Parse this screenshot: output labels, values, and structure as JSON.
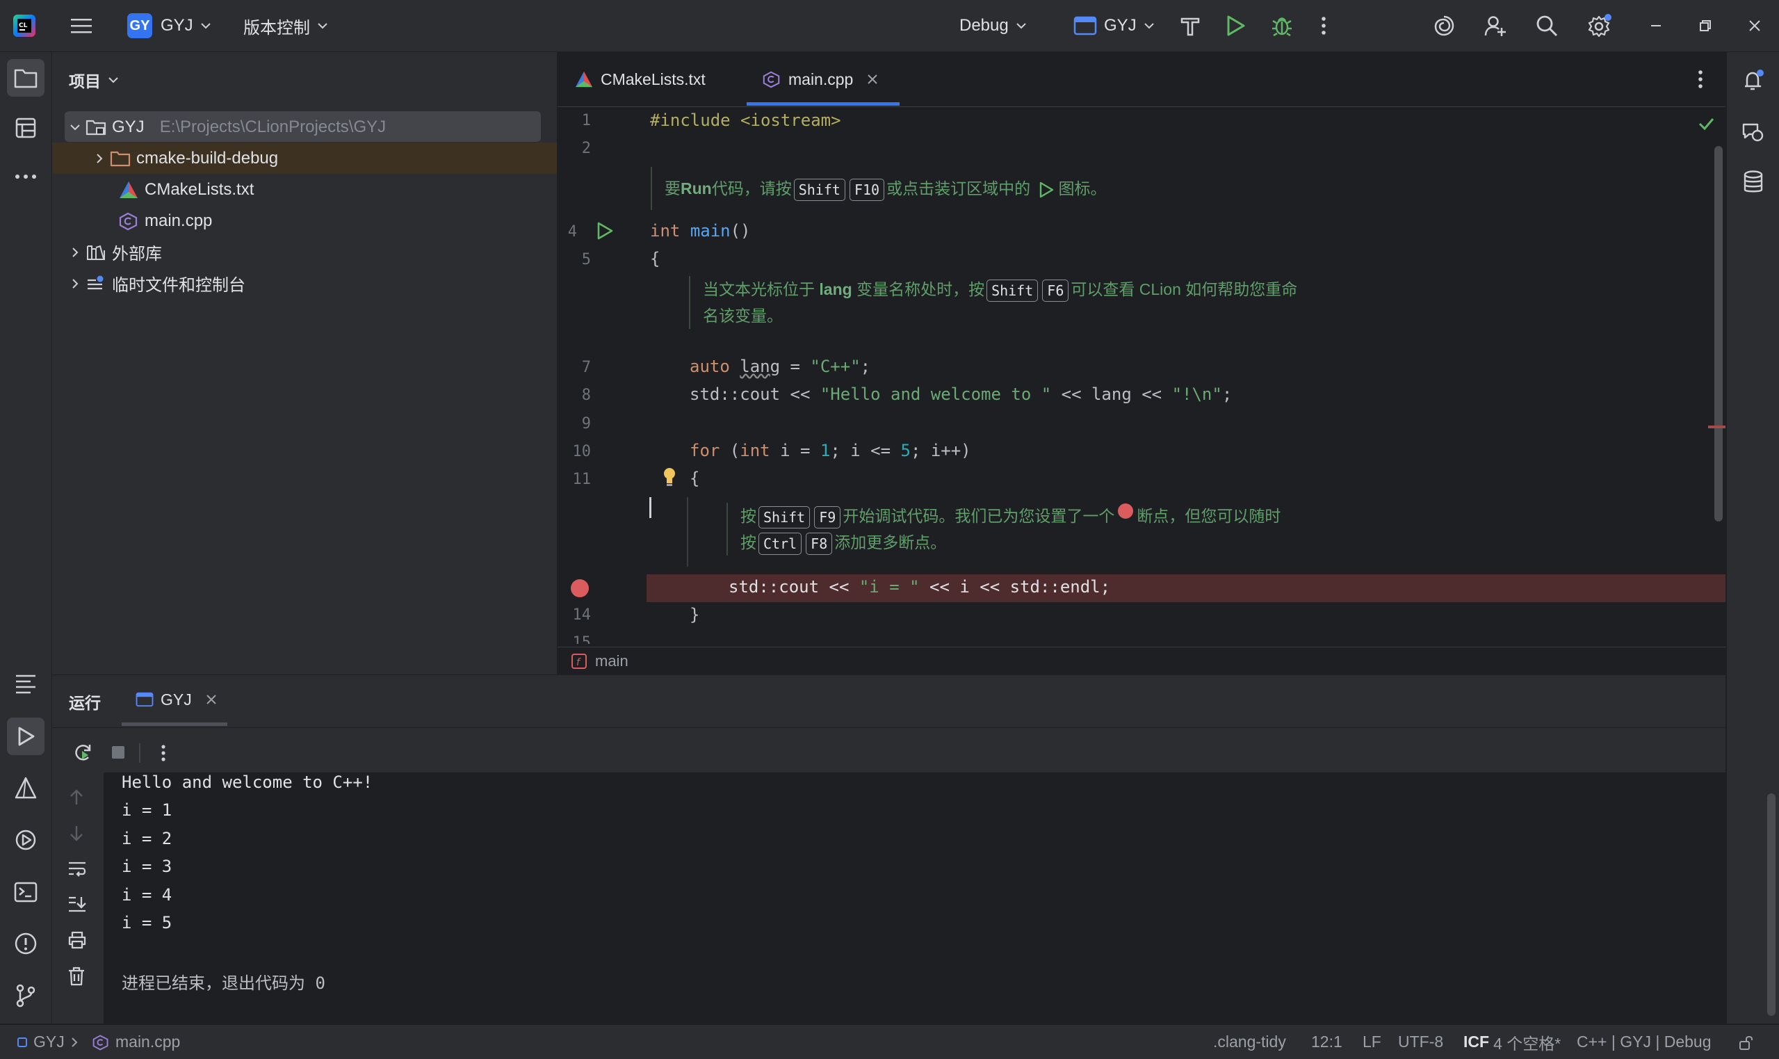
{
  "title_bar": {
    "project_badge": "GY",
    "project_name": "GYJ",
    "vcs_menu": "版本控制",
    "config_name": "Debug",
    "run_target": "GYJ"
  },
  "project_panel": {
    "title": "项目",
    "tree": [
      {
        "label": "GYJ",
        "path": "E:\\Projects\\CLionProjects\\GYJ"
      },
      {
        "label": "cmake-build-debug"
      },
      {
        "label": "CMakeLists.txt"
      },
      {
        "label": "main.cpp"
      },
      {
        "label": "外部库"
      },
      {
        "label": "临时文件和控制台"
      }
    ]
  },
  "editor": {
    "tabs": [
      {
        "label": "CMakeLists.txt"
      },
      {
        "label": "main.cpp"
      }
    ],
    "line_numbers": [
      "1",
      "2",
      "4",
      "5",
      "7",
      "8",
      "9",
      "10",
      "11",
      "14",
      "15"
    ],
    "code": {
      "l1": "#include <iostream>",
      "l4_kw": "int",
      "l4_fn": "main",
      "l4_rest": "()",
      "l5": "{",
      "l7_kw": "auto",
      "l7_var": "lang",
      "l7_eq": " = ",
      "l7_str": "\"C++\"",
      "l7_end": ";",
      "l8_a": "std::cout << ",
      "l8_str1": "\"Hello and welcome to \"",
      "l8_b": " << lang << ",
      "l8_str2": "\"!\\n\"",
      "l8_end": ";",
      "l10_for": "for",
      "l10_a": " (",
      "l10_int": "int",
      "l10_b": " i = ",
      "l10_one": "1",
      "l10_c": "; i <= ",
      "l10_five": "5",
      "l10_d": "; i++)",
      "l11": "{",
      "l13_a": "std::cout << ",
      "l13_str": "\"i = \"",
      "l13_b": " << i << std::endl;",
      "l14": "}"
    },
    "tips": {
      "run_1": "要",
      "run_bold": "Run",
      "run_2": "代码，请按",
      "run_k1": "Shift",
      "run_k2": "F10",
      "run_3": "或点击装订区域中的",
      "run_4": "图标。",
      "rename_1": "当文本光标位于",
      "rename_bold": "lang",
      "rename_2": "变量名称处时，按",
      "rename_k1": "Shift",
      "rename_k2": "F6",
      "rename_3": "可以查看 CLion 如何帮助您重命",
      "rename_4": "名该变量。",
      "debug_1": "按",
      "debug_k1": "Shift",
      "debug_k2": "F9",
      "debug_2": "开始调试代码。我们已为您设置了一个",
      "debug_3": "断点，但您可以随时",
      "debug_4": "按",
      "debug_k3": "Ctrl",
      "debug_k4": "F8",
      "debug_5": "添加更多断点。"
    },
    "breadcrumb": "main"
  },
  "run_panel": {
    "title": "运行",
    "tab": "GYJ",
    "output": [
      "Hello and welcome to C++!",
      "i = 1",
      "i = 2",
      "i = 3",
      "i = 4",
      "i = 5",
      "",
      "进程已结束，退出代码为 0"
    ]
  },
  "status_bar": {
    "project": "GYJ",
    "file": "main.cpp",
    "linter": ".clang-tidy",
    "position": "12:1",
    "line_ending": "LF",
    "encoding": "UTF-8",
    "indent_prefix": "ICF",
    "indent": "4 个空格*",
    "context": "C++ | GYJ | Debug"
  },
  "colors": {
    "accent": "#3574f0",
    "run_green": "#5fb865",
    "breakpoint_red": "#db5c5c",
    "folder_orange": "#cf8e6d"
  }
}
